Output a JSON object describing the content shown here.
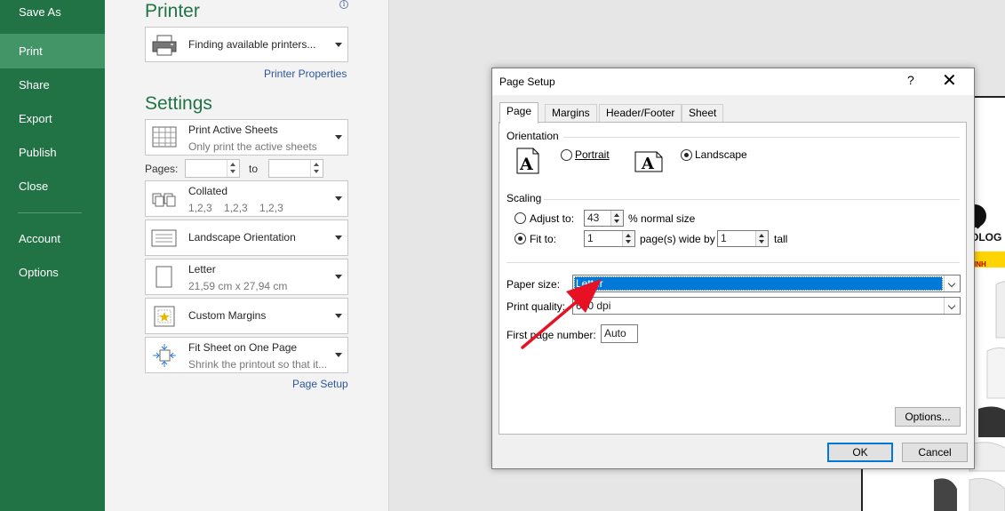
{
  "nav": {
    "items": [
      "Save As",
      "Print",
      "Share",
      "Export",
      "Publish",
      "Close"
    ],
    "items2": [
      "Account",
      "Options"
    ],
    "active": "Print"
  },
  "printer": {
    "title": "Printer",
    "info_icon": "i",
    "selected": "Finding available printers...",
    "properties_link": "Printer Properties"
  },
  "settings": {
    "title": "Settings",
    "what": {
      "line1": "Print Active Sheets",
      "line2": "Only print the active sheets"
    },
    "pages_label": "Pages:",
    "to_label": "to",
    "pages_from": "",
    "pages_to": "",
    "collated": {
      "line1": "Collated",
      "line2": "1,2,3    1,2,3    1,2,3"
    },
    "orientation": {
      "line1": "Landscape Orientation"
    },
    "paper": {
      "line1": "Letter",
      "line2": "21,59 cm x 27,94 cm"
    },
    "margins": {
      "line1": "Custom Margins"
    },
    "scaling": {
      "line1": "Fit Sheet on One Page",
      "line2": "Shrink the printout so that it..."
    },
    "page_setup_link": "Page Setup"
  },
  "dialog": {
    "title": "Page Setup",
    "help": "?",
    "close": "✕",
    "tabs": [
      "Page",
      "Margins",
      "Header/Footer",
      "Sheet"
    ],
    "active_tab": "Page",
    "orientation_label": "Orientation",
    "portrait": "Portrait",
    "landscape": "Landscape",
    "orientation_selected": "landscape",
    "scaling_label": "Scaling",
    "adjust_to": "Adjust to:",
    "adjust_value": "43",
    "normal_size": "% normal size",
    "fit_to": "Fit to:",
    "fit_wide": "1",
    "pages_wide_by": "page(s) wide by",
    "fit_tall": "1",
    "tall": "tall",
    "scaling_selected": "fit",
    "paper_size_label": "Paper size:",
    "paper_size_value": "Letter",
    "print_quality_label": "Print quality:",
    "print_quality_value": "600 dpi",
    "first_page_label": "First page number:",
    "first_page_value": "Auto",
    "options_button": "Options...",
    "ok_button": "OK",
    "cancel_button": "Cancel"
  },
  "preview_text": {
    "logo_fragment": "OLOG",
    "badge_fragment": "INH"
  },
  "colors": {
    "nav": "#217346",
    "nav_active": "#439467",
    "accent_text": "#217346",
    "link": "#2b579a",
    "selection": "#0078d7",
    "annotation_arrow": "#e81123"
  }
}
